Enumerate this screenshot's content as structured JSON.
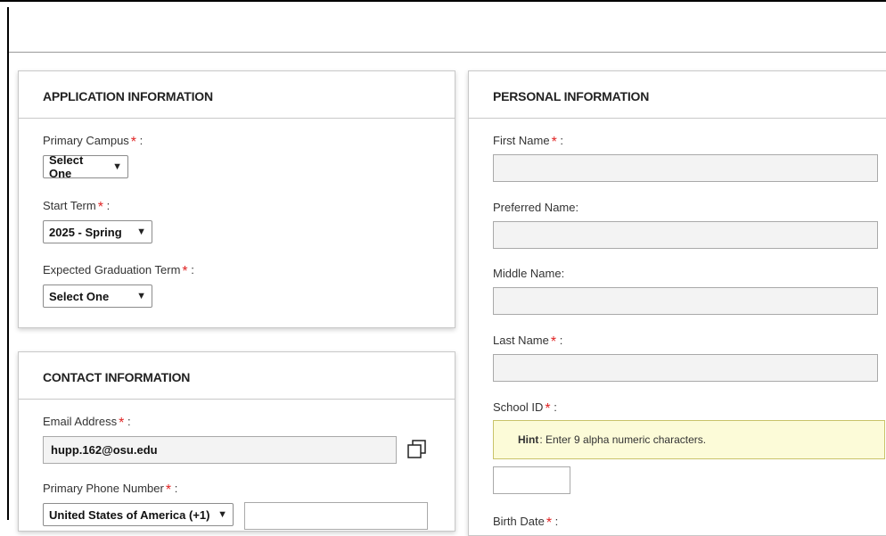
{
  "application": {
    "title": "APPLICATION INFORMATION",
    "primary_campus": {
      "label": "Primary Campus",
      "value": "Select One"
    },
    "start_term": {
      "label": "Start Term",
      "value": "2025 - Spring"
    },
    "graduation_term": {
      "label": "Expected Graduation Term",
      "value": "Select One"
    }
  },
  "contact": {
    "title": "CONTACT INFORMATION",
    "email": {
      "label": "Email Address",
      "value": "hupp.162@osu.edu"
    },
    "phone": {
      "label": "Primary Phone Number",
      "country": "United States of America (+1)",
      "value": ""
    }
  },
  "personal": {
    "title": "PERSONAL INFORMATION",
    "first_name": {
      "label": "First Name",
      "value": ""
    },
    "preferred_name": {
      "label": "Preferred Name:",
      "value": ""
    },
    "middle_name": {
      "label": "Middle Name:",
      "value": ""
    },
    "last_name": {
      "label": "Last Name",
      "value": ""
    },
    "school_id": {
      "label": "School ID",
      "hint_prefix": "Hint",
      "hint_text": ": Enter 9 alpha numeric characters.",
      "value": ""
    },
    "birth_date": {
      "label": "Birth Date"
    }
  },
  "required_marker": "*",
  "colon": ":",
  "icons": {
    "copy": "copy-icon",
    "dropdown": "chevron-down-icon"
  },
  "colors": {
    "required": "#e02424",
    "hint_bg": "#fcfbd8",
    "field_bg": "#f3f3f3"
  }
}
